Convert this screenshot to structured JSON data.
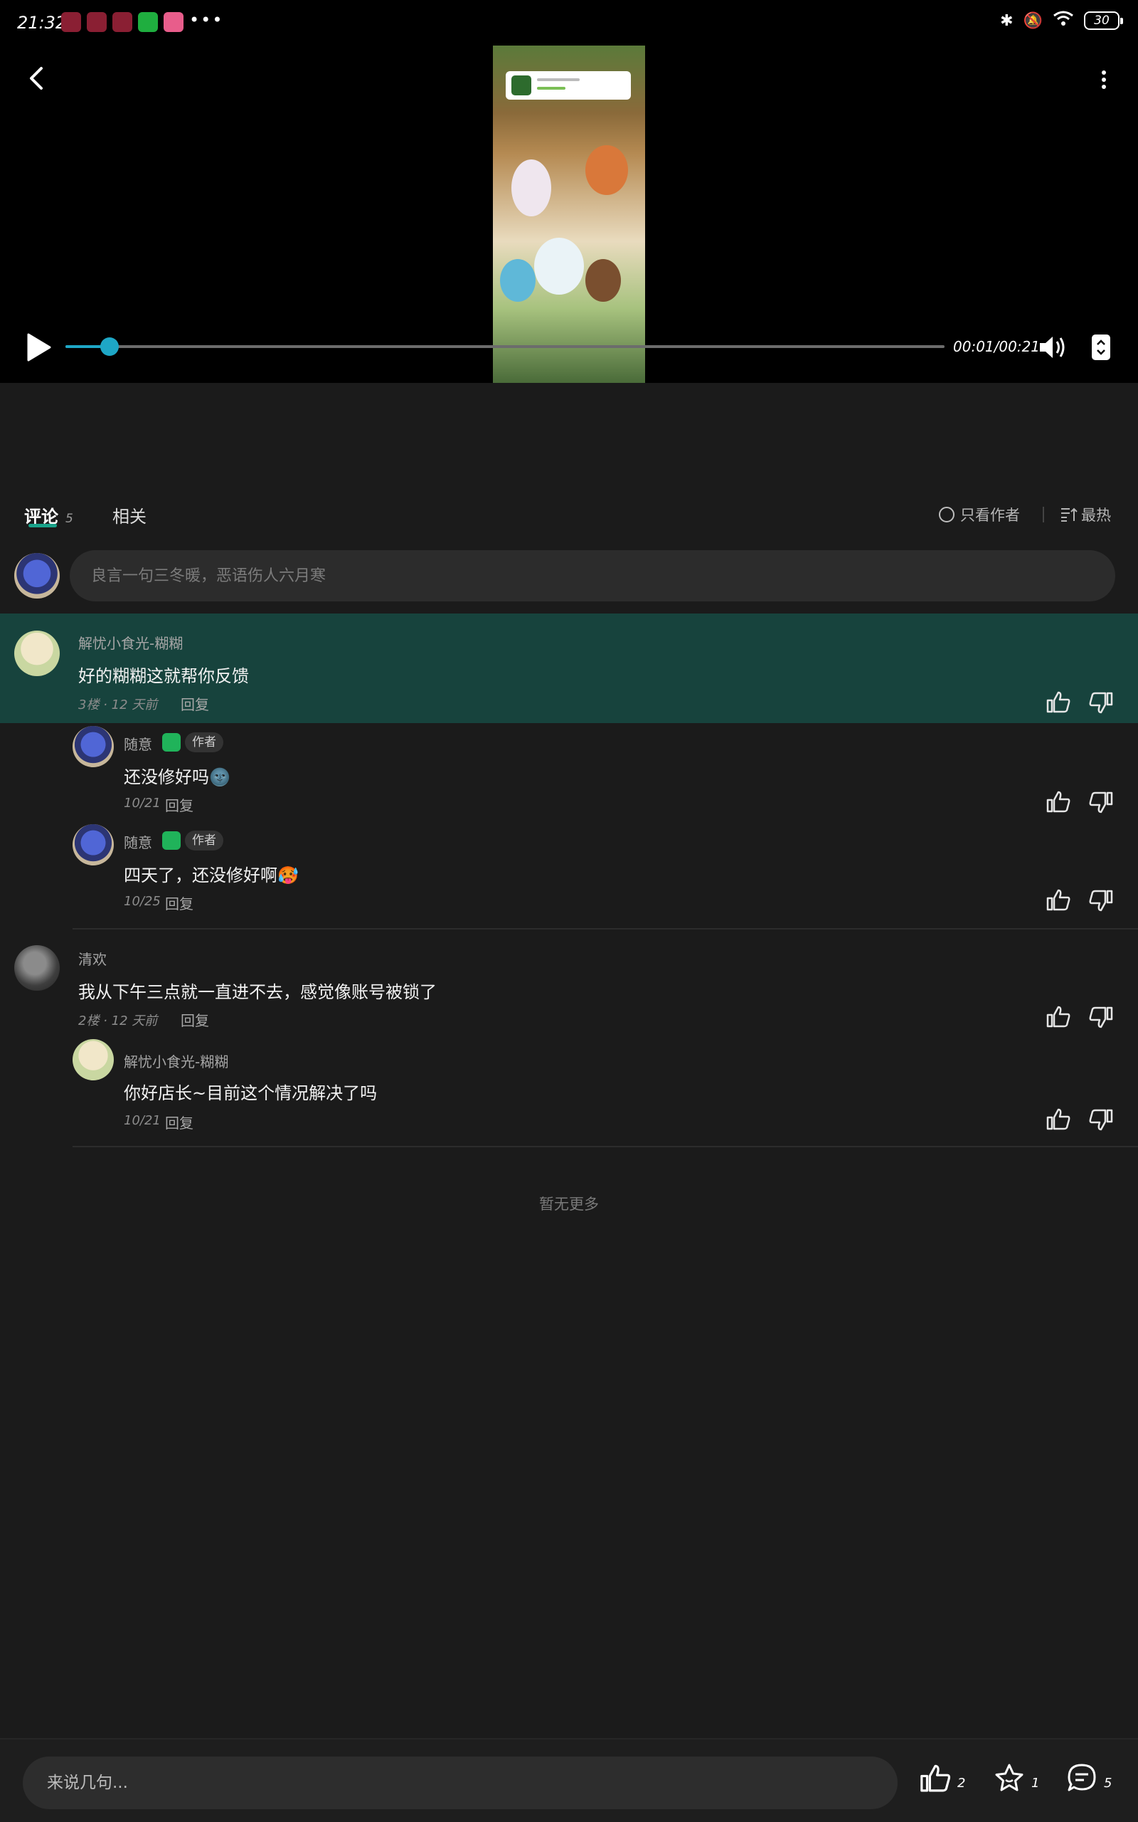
{
  "status_bar": {
    "time": "21:32",
    "battery": "30",
    "overflow": "•••"
  },
  "video": {
    "time_display": "00:01/00:21",
    "progress": 0.05
  },
  "tabs": [
    {
      "label": "评论",
      "count": "5"
    },
    {
      "label": "相关"
    }
  ],
  "filters": {
    "author_only": "只看作者",
    "sort": "最热"
  },
  "input": {
    "placeholder": "良言一句三冬暖，恶语伤人六月寒"
  },
  "comments": [
    {
      "user": "解忧小食光-糊糊",
      "text": "好的糊糊这就帮你反馈",
      "floor": "3楼 · 12 天前",
      "reply_label": "回复",
      "replies": [
        {
          "user": "随意",
          "badge": "作者",
          "text": "还没修好吗🌚",
          "date": "10/21",
          "reply_label": "回复"
        },
        {
          "user": "随意",
          "badge": "作者",
          "text": "四天了，还没修好啊🥵",
          "date": "10/25",
          "reply_label": "回复"
        }
      ]
    },
    {
      "user": "清欢",
      "text": "我从下午三点就一直进不去，感觉像账号被锁了",
      "floor": "2楼 · 12 天前",
      "reply_label": "回复",
      "replies": [
        {
          "user": "解忧小食光-糊糊",
          "text": "你好店长~目前这个情况解决了吗",
          "date": "10/21",
          "reply_label": "回复"
        }
      ]
    }
  ],
  "no_more": "暂无更多",
  "bottom_bar": {
    "placeholder": "来说几句...",
    "likes": "2",
    "favorites": "1",
    "comments": "5"
  },
  "colors": {
    "accent": "#1ea7c6",
    "tab_indicator": "#1aa38a",
    "highlight_bg": "#17433d",
    "author_badge": "#20b35a"
  }
}
